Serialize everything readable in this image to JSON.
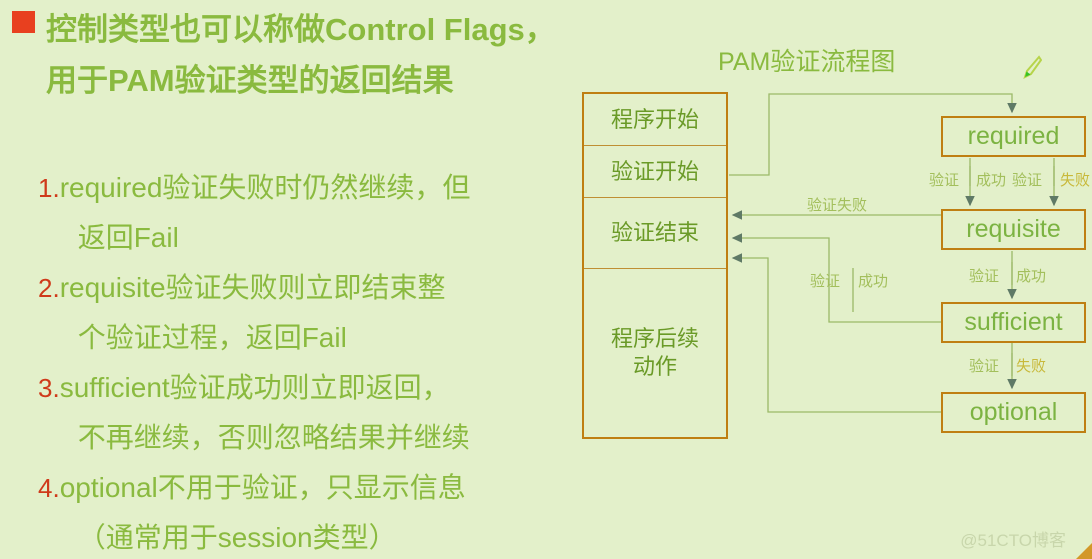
{
  "slide": {
    "background_color": "#e3f0ca",
    "heading_color": "#8aba3f",
    "number_color": "#cf3a1a",
    "box_border_color": "#bf7f12",
    "bullet_color": "#e8401f",
    "heading": "控制类型也可以称做Control Flags，用于PAM验证类型的返回结果",
    "items": [
      {
        "num": "1.",
        "line1": "required验证失败时仍然继续，但",
        "line2": "返回Fail"
      },
      {
        "num": "2.",
        "line1": "requisite验证失败则立即结束整",
        "line2": "个验证过程，返回Fail"
      },
      {
        "num": "3.",
        "line1": "sufficient验证成功则立即返回，",
        "line2": "不再继续，否则忽略结果并继续"
      },
      {
        "num": "4.",
        "line1": "optional不用于验证，只显示信息",
        "line2": "（通常用于session类型）"
      }
    ]
  },
  "diagram": {
    "title": "PAM验证流程图",
    "flow_rows": [
      "程序开始",
      "验证开始",
      "验证结束",
      "程序后续\n动作"
    ],
    "flow_rows_display": {
      "r1": "程序开始",
      "r2": "验证开始",
      "r3": "验证结束",
      "r4a": "程序后续",
      "r4b": "动作"
    },
    "stages": {
      "required": "required",
      "requisite": "requisite",
      "sufficient": "sufficient",
      "optional": "optional"
    },
    "edge_labels": {
      "required_success_a": "验证",
      "required_success_b": "成功",
      "required_fail_a": "验证",
      "required_fail_b": "失败",
      "requisite_fail": "验证失败",
      "requisite_success_a": "验证",
      "requisite_success_b": "成功",
      "sufficient_success_a": "验证",
      "sufficient_success_b": "成功",
      "sufficient_fail_a": "验证",
      "sufficient_fail_b": "失败"
    }
  },
  "watermark": "@51CTO博客"
}
